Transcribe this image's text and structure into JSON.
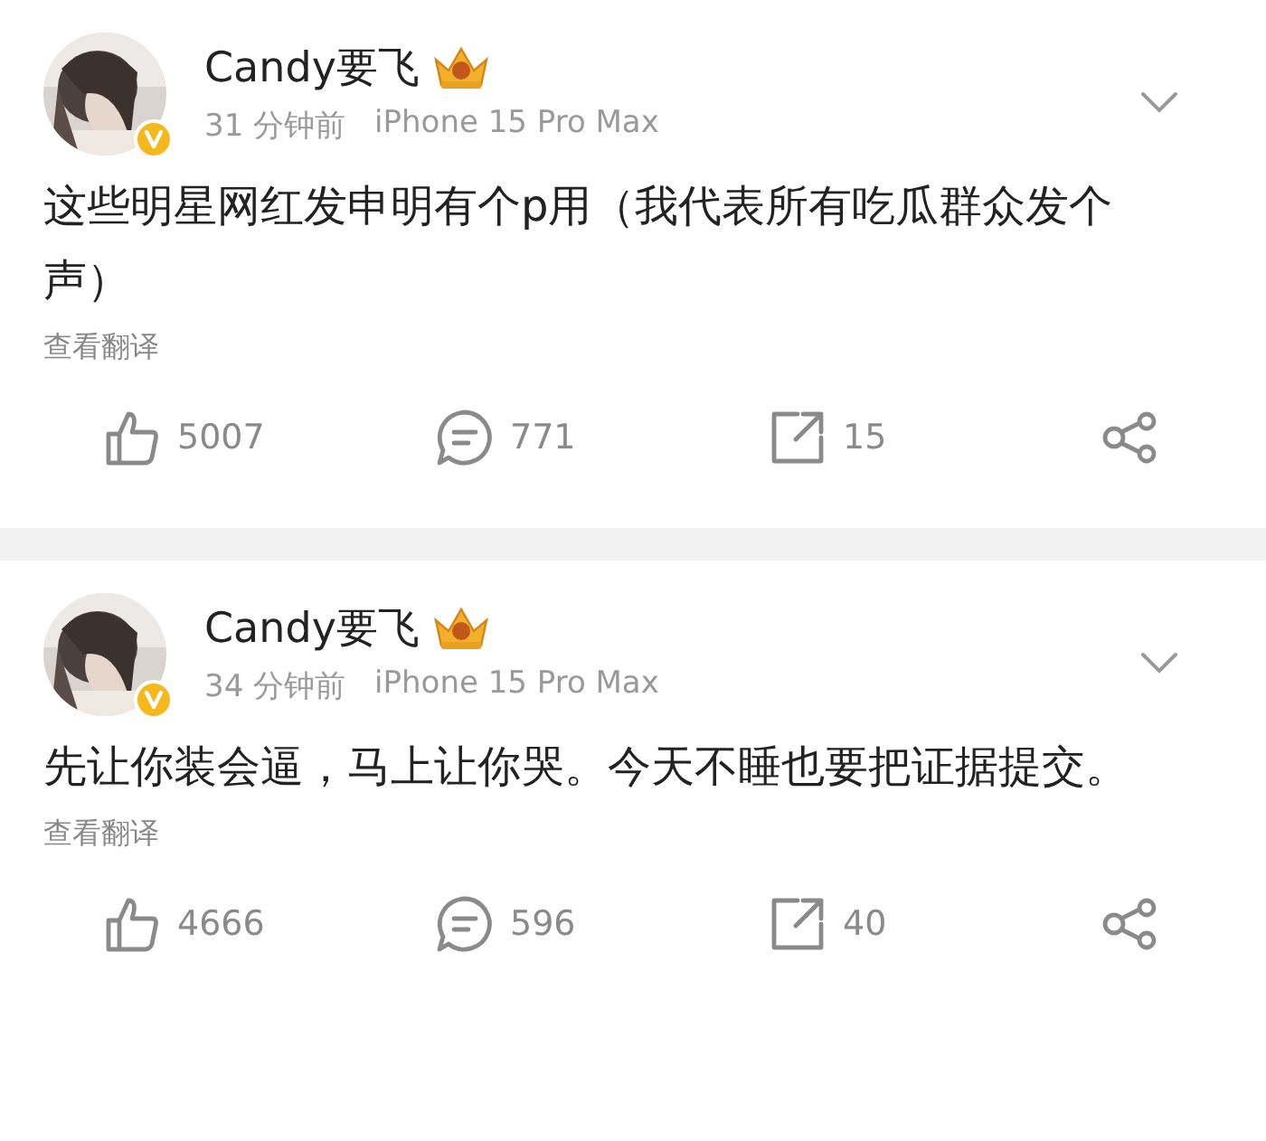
{
  "posts": [
    {
      "author": "Candy要飞",
      "time": "31 分钟前",
      "device": "iPhone 15 Pro Max",
      "verified": true,
      "text": "这些明星网红发申明有个p用（我代表所有吃瓜群众发个声）",
      "translate": "查看翻译",
      "likes": "5007",
      "comments": "771",
      "reposts": "15"
    },
    {
      "author": "Candy要飞",
      "time": "34 分钟前",
      "device": "iPhone 15 Pro Max",
      "verified": true,
      "text": "先让你装会逼，马上让你哭。今天不睡也要把证据提交。",
      "translate": "查看翻译",
      "likes": "4666",
      "comments": "596",
      "reposts": "40"
    }
  ]
}
